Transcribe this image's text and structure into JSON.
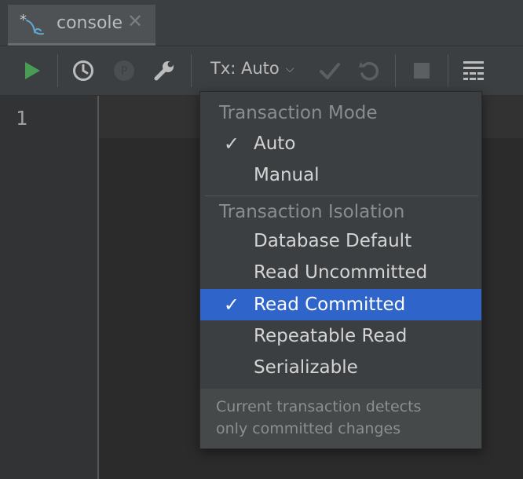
{
  "tab": {
    "label": "console",
    "icon": "mysql-dolphin-icon",
    "close_symbol": "✕"
  },
  "toolbar": {
    "run_icon": "run-icon",
    "history_icon": "history-icon",
    "pin_icon": "pin-icon",
    "settings_icon": "wrench-icon",
    "tx_label": "Tx: Auto",
    "commit_icon": "commit-check-icon",
    "rollback_icon": "rollback-icon",
    "stop_icon": "stop-icon",
    "output_icon": "table-view-icon"
  },
  "editor": {
    "line_number": "1"
  },
  "popup": {
    "mode_header": "Transaction Mode",
    "mode_items": [
      {
        "label": "Auto",
        "checked": true
      },
      {
        "label": "Manual",
        "checked": false
      }
    ],
    "isolation_header": "Transaction Isolation",
    "isolation_items": [
      {
        "label": "Database Default",
        "checked": false
      },
      {
        "label": "Read Uncommitted",
        "checked": false
      },
      {
        "label": "Read Committed",
        "checked": true,
        "selected": true
      },
      {
        "label": "Repeatable Read",
        "checked": false
      },
      {
        "label": "Serializable",
        "checked": false
      }
    ],
    "check_symbol": "✓",
    "footer_line1": "Current transaction detects",
    "footer_line2": "only committed changes"
  },
  "colors": {
    "selection": "#2f65ca",
    "run_green": "#499c54",
    "background": "#2b2b2b",
    "toolbar_bg": "#3c3f41"
  }
}
